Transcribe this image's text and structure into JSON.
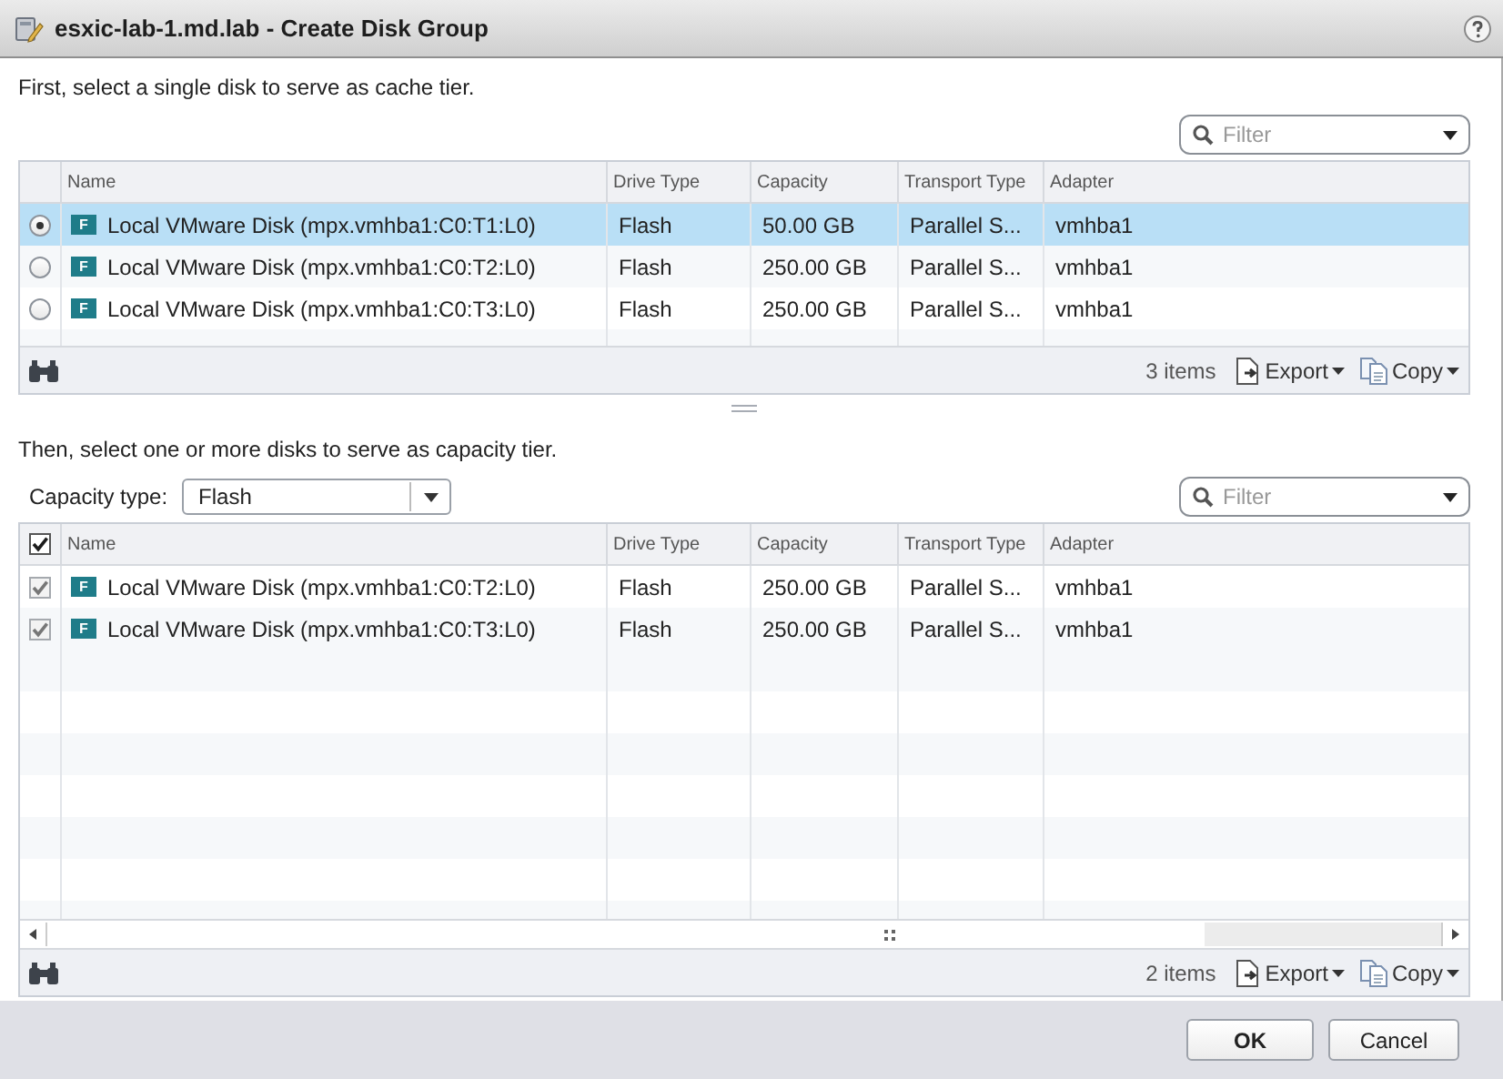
{
  "window": {
    "title": "esxic-lab-1.md.lab - Create Disk Group"
  },
  "sections": [
    {
      "kind": "radio",
      "instruction": "First, select a single disk to serve as cache tier.",
      "filter": {
        "placeholder": "Filter"
      },
      "columns": [
        "Name",
        "Drive Type",
        "Capacity",
        "Transport Type",
        "Adapter"
      ],
      "rows": [
        {
          "selected": true,
          "badge": "F",
          "name": "Local VMware Disk (mpx.vmhba1:C0:T1:L0)",
          "drive_type": "Flash",
          "capacity": "50.00 GB",
          "transport": "Parallel S...",
          "adapter": "vmhba1"
        },
        {
          "selected": false,
          "badge": "F",
          "name": "Local VMware Disk (mpx.vmhba1:C0:T2:L0)",
          "drive_type": "Flash",
          "capacity": "250.00 GB",
          "transport": "Parallel S...",
          "adapter": "vmhba1"
        },
        {
          "selected": false,
          "badge": "F",
          "name": "Local VMware Disk (mpx.vmhba1:C0:T3:L0)",
          "drive_type": "Flash",
          "capacity": "250.00 GB",
          "transport": "Parallel S...",
          "adapter": "vmhba1"
        }
      ],
      "count": "3 items",
      "actions": [
        "Export",
        "Copy"
      ]
    },
    {
      "kind": "checkbox",
      "instruction": "Then, select one or more disks to serve as capacity tier.",
      "capacity_type": {
        "label": "Capacity type:",
        "value": "Flash"
      },
      "filter": {
        "placeholder": "Filter"
      },
      "select_all_checked": true,
      "columns": [
        "Name",
        "Drive Type",
        "Capacity",
        "Transport Type",
        "Adapter"
      ],
      "rows": [
        {
          "checked": true,
          "badge": "F",
          "name": "Local VMware Disk (mpx.vmhba1:C0:T2:L0)",
          "drive_type": "Flash",
          "capacity": "250.00 GB",
          "transport": "Parallel S...",
          "adapter": "vmhba1"
        },
        {
          "checked": true,
          "badge": "F",
          "name": "Local VMware Disk (mpx.vmhba1:C0:T3:L0)",
          "drive_type": "Flash",
          "capacity": "250.00 GB",
          "transport": "Parallel S...",
          "adapter": "vmhba1"
        }
      ],
      "count": "2 items",
      "actions": [
        "Export",
        "Copy"
      ]
    }
  ],
  "buttons": [
    {
      "label": "OK",
      "primary": true
    },
    {
      "label": "Cancel",
      "primary": false
    }
  ]
}
